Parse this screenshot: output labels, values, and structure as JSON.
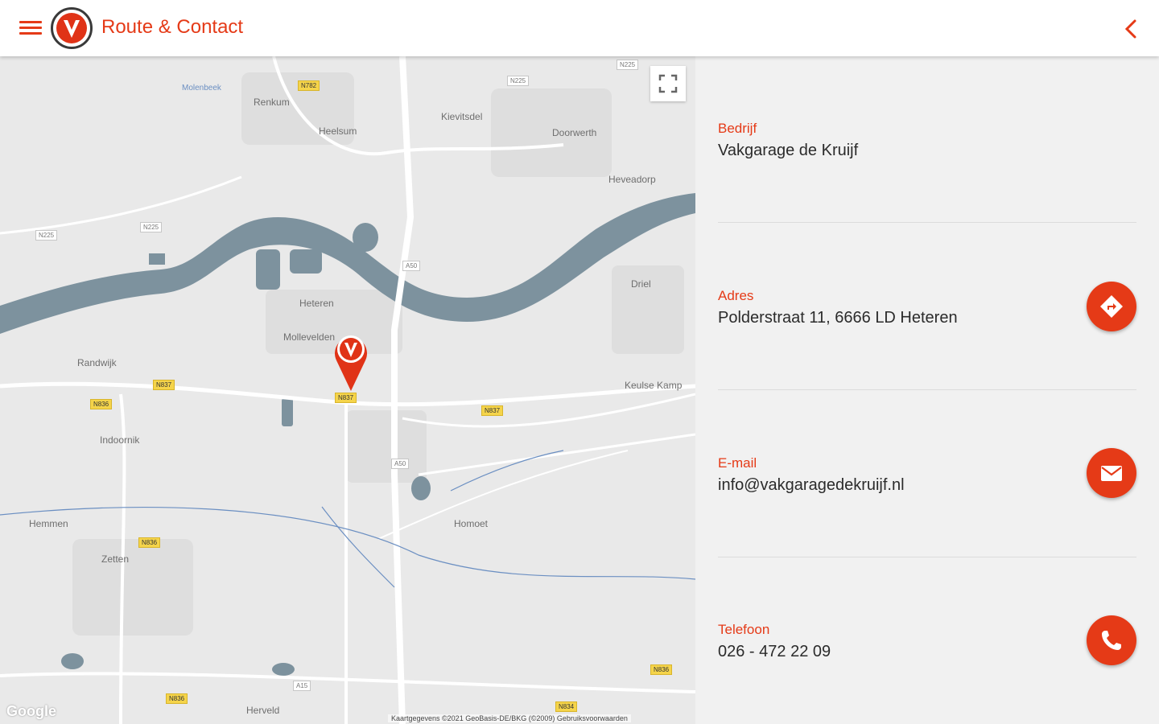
{
  "header": {
    "title": "Route & Contact",
    "menu_icon": "hamburger-menu-icon",
    "back_icon": "chevron-left-icon",
    "accent_color": "#e53a17",
    "logo_letter": "V"
  },
  "map": {
    "labels": {
      "renkum": "Renkum",
      "heelsum": "Heelsum",
      "kievitsdel": "Kievitsdel",
      "doorwerth": "Doorwerth",
      "heveadorp": "Heveadorp",
      "heteren": "Heteren",
      "driel": "Driel",
      "randwijk": "Randwijk",
      "indoornik": "Indoornik",
      "heteren_west": "Hemmen",
      "zetten": "Zetten",
      "homoet": "Homoet",
      "keulse_kamp": "Keulse Kamp",
      "herveld": "Herveld",
      "molenbeek": "Molenbeek",
      "oosterbeek_bos": "Mollevelden"
    },
    "roads": [
      "N782",
      "N225",
      "N225",
      "N225",
      "N225",
      "N837",
      "N836",
      "N837",
      "N837",
      "N836",
      "N836",
      "N836",
      "N834",
      "A50",
      "A50",
      "A15"
    ],
    "google_label": "Google",
    "attribution": "Kaartgegevens ©2021 GeoBasis-DE/BKG (©2009)   Gebruiksvoorwaarden",
    "water_color": "#7d929e"
  },
  "contact": {
    "company": {
      "label": "Bedrijf",
      "value": "Vakgarage de Kruijf"
    },
    "address": {
      "label": "Adres",
      "value": "Polderstraat 11, 6666 LD Heteren",
      "icon": "directions-icon"
    },
    "email": {
      "label": "E-mail",
      "value": "info@vakgaragedekruijf.nl",
      "icon": "mail-icon"
    },
    "phone": {
      "label": "Telefoon",
      "value": "026 - 472 22 09",
      "icon": "phone-icon"
    }
  }
}
